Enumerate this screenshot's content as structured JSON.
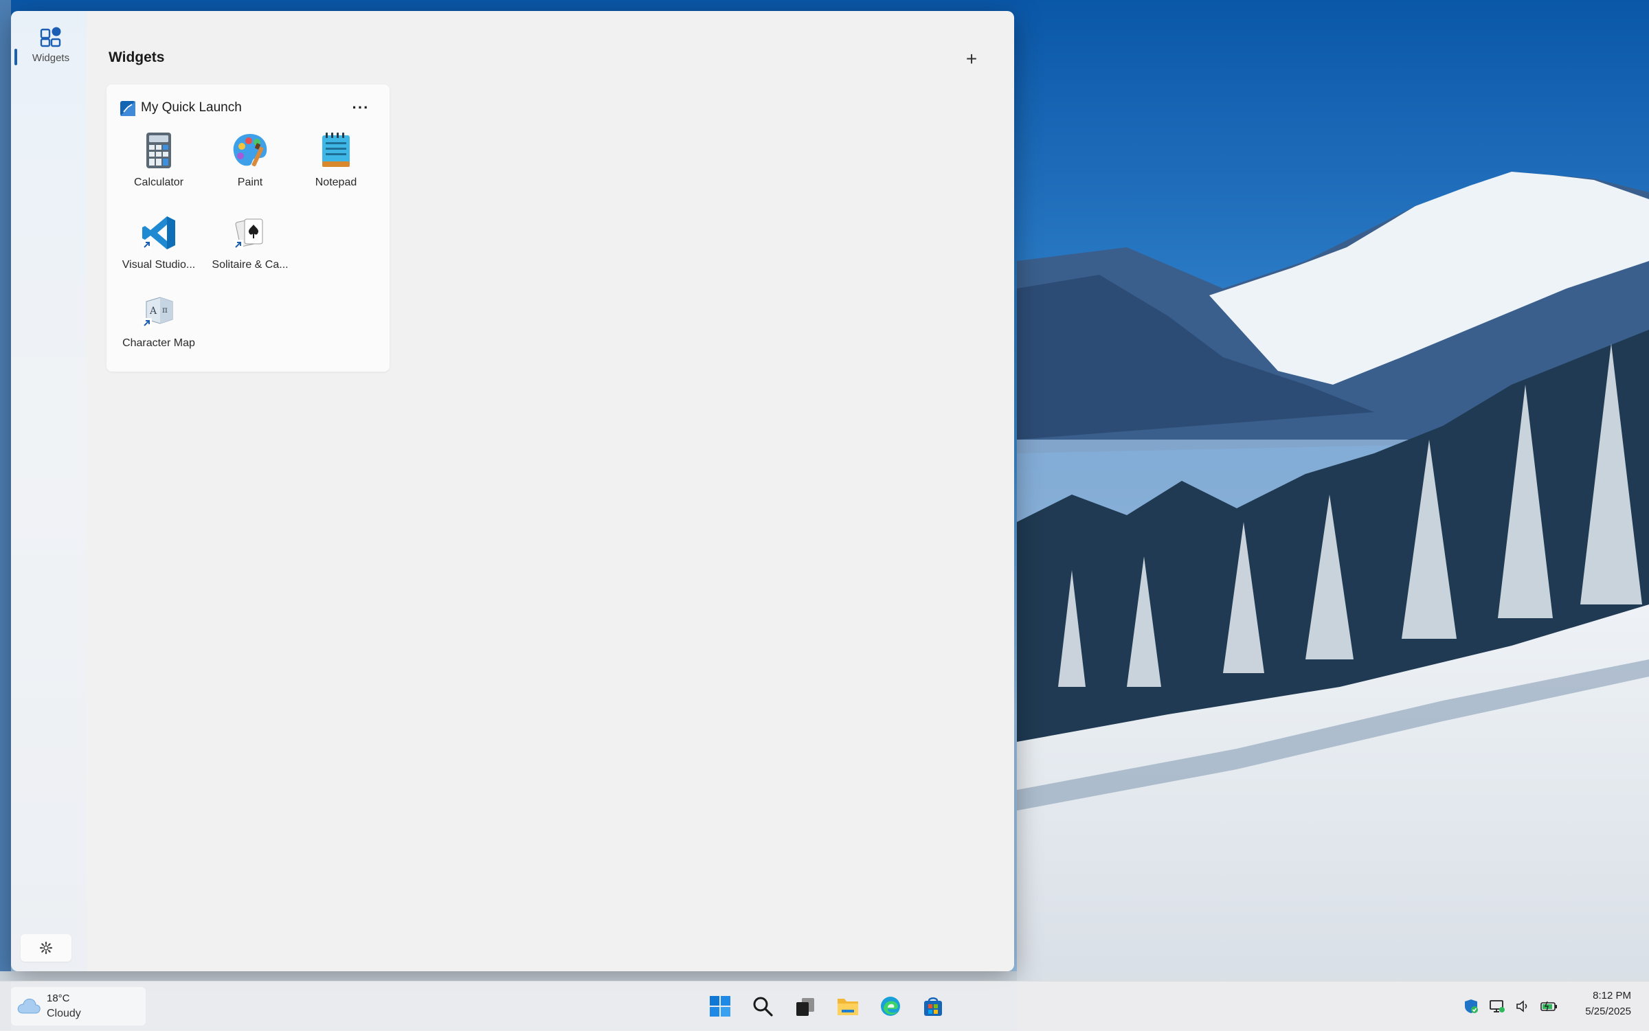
{
  "window": {
    "title": "Widgets",
    "rail_label": "Widgets"
  },
  "quick_launch": {
    "title": "My Quick Launch",
    "more_label": "···",
    "apps": [
      {
        "label": "Calculator",
        "icon": "calculator-icon"
      },
      {
        "label": "Paint",
        "icon": "paint-icon"
      },
      {
        "label": "Notepad",
        "icon": "notepad-icon"
      },
      {
        "label": "Visual Studio...",
        "icon": "vscode-icon"
      },
      {
        "label": "Solitaire & Ca...",
        "icon": "solitaire-icon"
      },
      {
        "label": "Character Map",
        "icon": "character-map-icon"
      }
    ]
  },
  "board": {
    "add_label": "+"
  },
  "taskbar": {
    "weather": {
      "temp": "18°C",
      "condition": "Cloudy",
      "icon": "cloud-icon"
    },
    "pinned": [
      "start-icon",
      "search-icon",
      "task-view-icon",
      "file-explorer-icon",
      "edge-icon",
      "store-icon"
    ],
    "tray": [
      "defender-icon",
      "network-icon",
      "volume-icon",
      "battery-icon"
    ],
    "clock": {
      "time": "8:12 PM",
      "date": "5/25/2025"
    }
  },
  "colors": {
    "accent": "#1a5fb4",
    "board_bg": "#f1f1f1",
    "card_bg": "#fbfbfb",
    "sky_top": "#0b5fb4",
    "sky_bottom": "#7fb3e3"
  }
}
